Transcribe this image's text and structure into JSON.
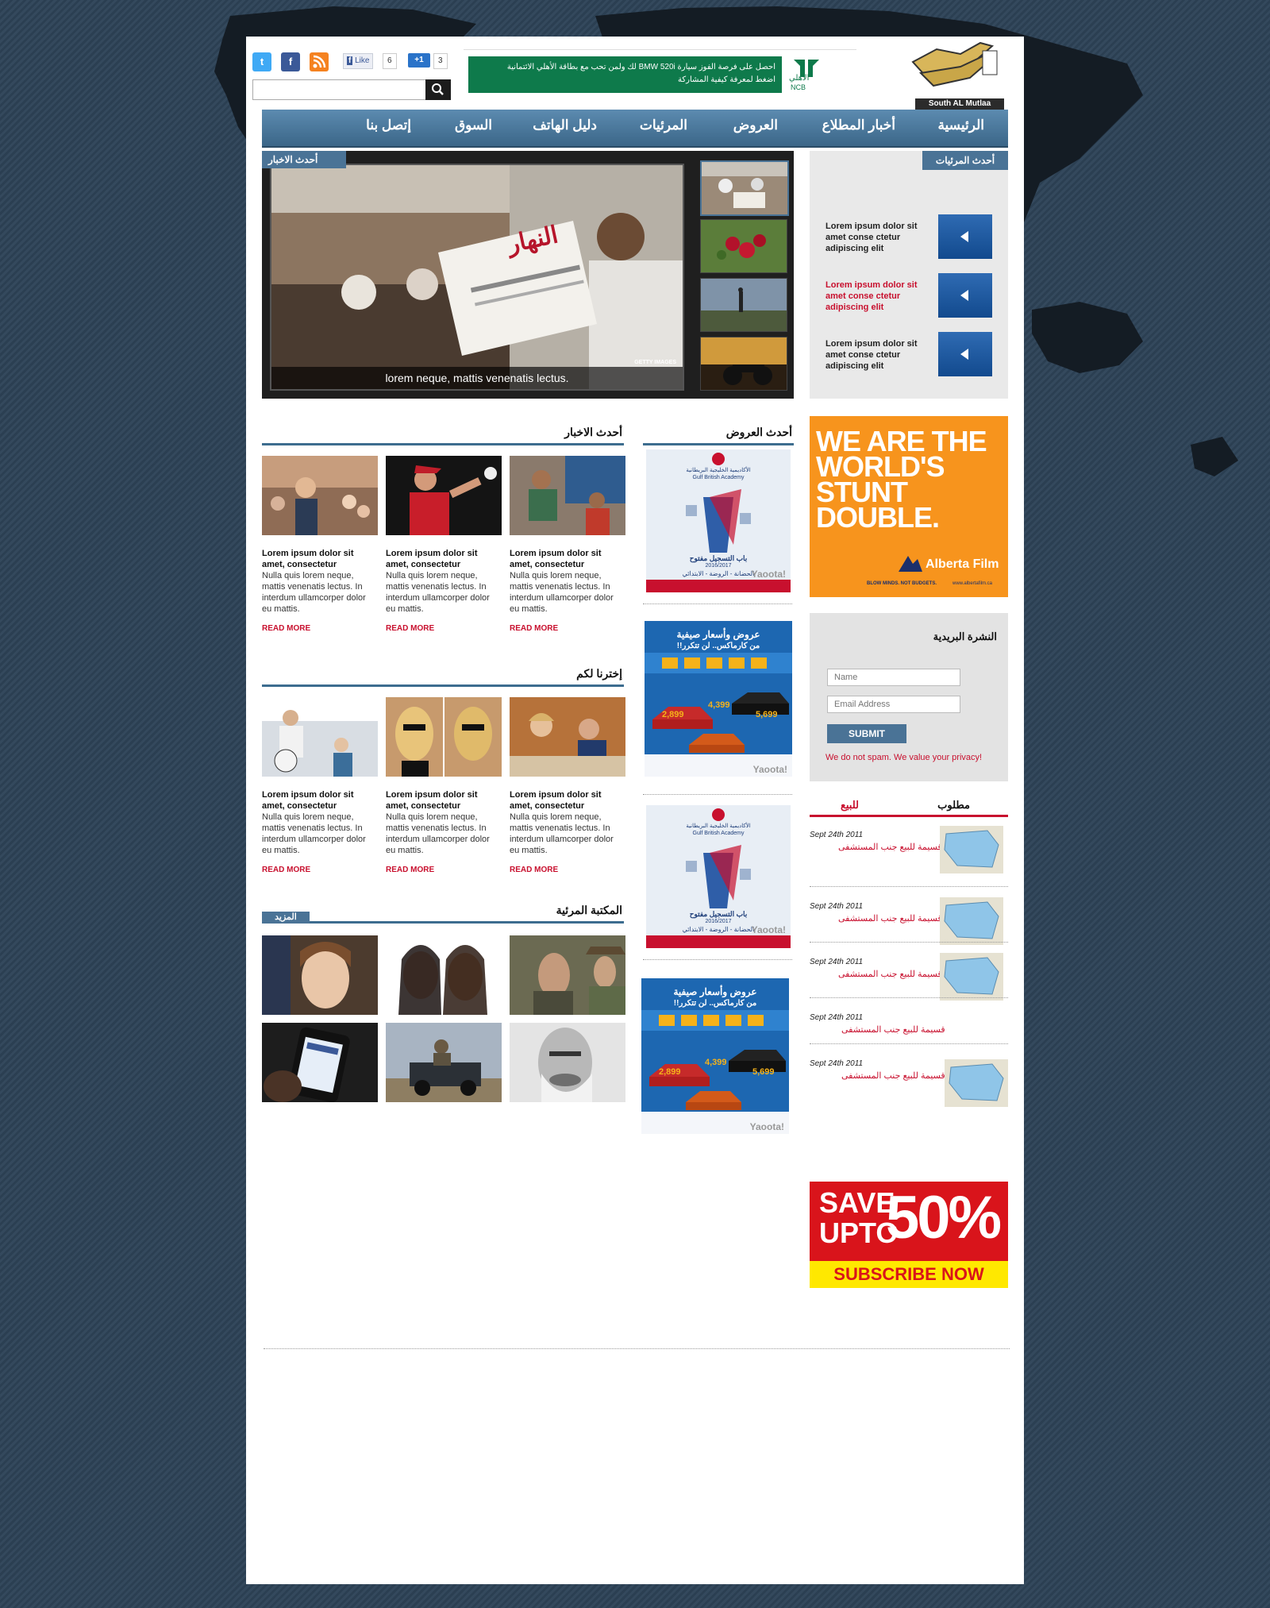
{
  "header": {
    "like_label": "Like",
    "like_count": "6",
    "plus_label": "+1",
    "plus_count": "3",
    "ncb_text_line1": "احصل على فرصة الفوز سيارة BMW 520i لك ولمن تحب مع بطاقة الأهلي الائتمانية",
    "ncb_text_line2": "اضغط لمعرفة كيفية المشاركة",
    "ncb_brand_ar": "الأهلي",
    "ncb_brand_en": "NCB",
    "logo_text": "South AL Mutlaa"
  },
  "nav": {
    "items": [
      "الرئيسية",
      "أخبار المطلاع",
      "العروض",
      "المرئيات",
      "دليل الهاتف",
      "السوق",
      "إتصل بنا"
    ]
  },
  "slider": {
    "label": "أحدث الاخبار",
    "caption": "lorem neque, mattis venenatis lectus.",
    "watermark": "GETTY IMAGES",
    "newspaper_title": "النهار"
  },
  "obituaries": {
    "tab": "أحدث المرئيات",
    "items": [
      {
        "text": "Lorem ipsum dolor sit amet conse ctetur adipiscing elit",
        "color": "#222222"
      },
      {
        "text": "Lorem ipsum dolor sit amet conse ctetur adipiscing elit",
        "color": "#c8102e"
      },
      {
        "text": "Lorem ipsum dolor sit amet conse ctetur adipiscing elit",
        "color": "#222222"
      }
    ]
  },
  "latest_news": {
    "title": "أحدث الاخبار",
    "cards": [
      {
        "title": "Lorem ipsum dolor sit amet, consectetur",
        "body": "Nulla quis lorem neque, mattis venenatis lectus. In interdum ullamcorper dolor eu mattis.",
        "more": "READ MORE"
      },
      {
        "title": "Lorem ipsum dolor sit amet, consectetur",
        "body": "Nulla quis lorem neque, mattis venenatis lectus. In interdum ullamcorper dolor eu mattis.",
        "more": "READ MORE"
      },
      {
        "title": "Lorem ipsum dolor sit amet, consectetur",
        "body": "Nulla quis lorem neque, mattis venenatis lectus. In interdum ullamcorper dolor eu mattis.",
        "more": "READ MORE"
      }
    ]
  },
  "picks": {
    "title": "إخترنا لكم",
    "cards": [
      {
        "title": "Lorem ipsum dolor sit amet, consectetur",
        "body": "Nulla quis lorem neque, mattis venenatis lectus. In interdum ullamcorper dolor eu mattis.",
        "more": "READ MORE"
      },
      {
        "title": "Lorem ipsum dolor sit amet, consectetur",
        "body": "Nulla quis lorem neque, mattis venenatis lectus. In interdum ullamcorper dolor eu mattis.",
        "more": "READ MORE"
      },
      {
        "title": "Lorem ipsum dolor sit amet, consectetur",
        "body": "Nulla quis lorem neque, mattis venenatis lectus. In interdum ullamcorper dolor eu mattis.",
        "more": "READ MORE"
      }
    ]
  },
  "gallery": {
    "title": "المكتبة المرئية",
    "more": "المزيد"
  },
  "offers": {
    "title": "أحدث العروض",
    "gulf": {
      "name_ar": "الأكاديمية الخليجية البريطانية",
      "name_en": "Gulf British Academy",
      "registration": "باب التسجيل مفتوح",
      "year": "2016/2017",
      "stages": "الحضانة - الروضة - الابتدائي",
      "watermark": "Yaoota!"
    },
    "carmax": {
      "headline": "عروض وأسعار صيفية",
      "subline": "من كارماكس.. لن تتكرر!!",
      "prices": [
        "2,899",
        "4,399",
        "5,699"
      ],
      "watermark": "Yaoota!"
    }
  },
  "ads": {
    "alberta_headline": [
      "WE ARE THE",
      "WORLD'S",
      "STUNT",
      "DOUBLE."
    ],
    "alberta_brand": "Alberta Film",
    "alberta_tagline": "BLOW MINDS. NOT BUDGETS.",
    "alberta_url": "www.albertafilm.ca",
    "save_line1": "SAVE",
    "save_line2": "UPTO",
    "save_percent": "50%",
    "save_cta": "SUBSCRIBE NOW"
  },
  "newsletter": {
    "title": "النشرة البريدية",
    "name_placeholder": "Name",
    "email_placeholder": "Email Address",
    "submit": "SUBMIT",
    "note": "We do not spam. We value your privacy!"
  },
  "classifieds": {
    "tab_wanted": "مطلوب",
    "tab_sale": "للبيع",
    "items": [
      {
        "date": "Sept 24th 2011",
        "title": "قسيمة للبيع جنب المستشفى",
        "has_image": true
      },
      {
        "date": "Sept 24th 2011",
        "title": "قسيمة للبيع جنب المستشفى",
        "has_image": true
      },
      {
        "date": "Sept 24th 2011",
        "title": "قسيمة للبيع جنب المستشفى",
        "has_image": true
      },
      {
        "date": "Sept 24th 2011",
        "title": "قسيمة للبيع جنب المستشفى",
        "has_image": false
      },
      {
        "date": "Sept 24th 2011",
        "title": "قسيمة للبيع جنب المستشفى",
        "has_image": true
      }
    ]
  },
  "colors": {
    "accent": "#4a7396",
    "red": "#c8102e",
    "ncb_green": "#0e7a4b",
    "alberta_orange": "#f7941d"
  },
  "icons": [
    "twitter-icon",
    "facebook-icon",
    "rss-icon",
    "search-icon",
    "arrow-left-icon"
  ]
}
